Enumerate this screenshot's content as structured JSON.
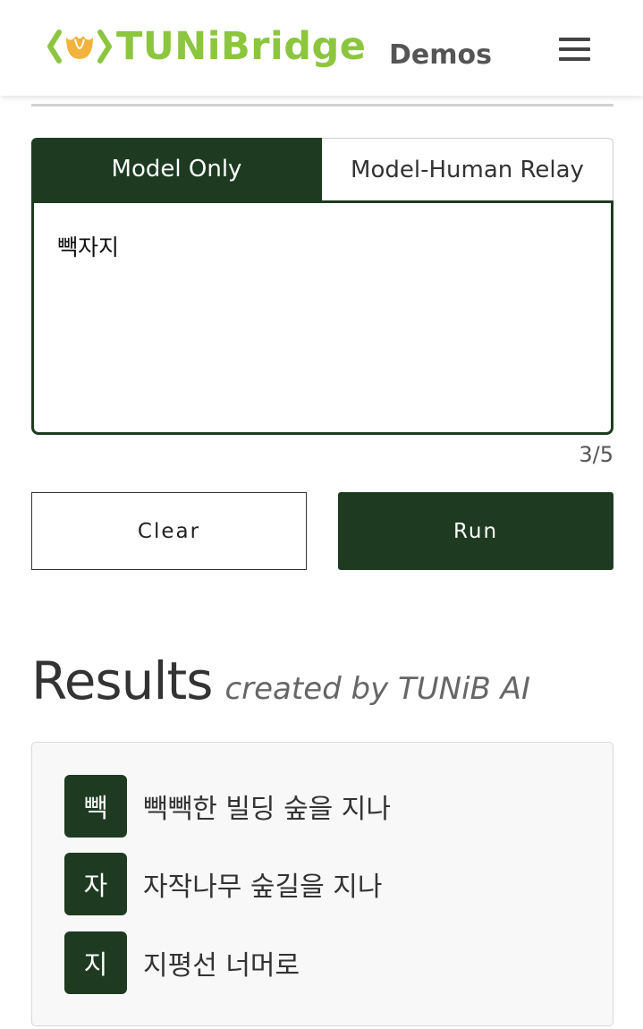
{
  "header": {
    "logo_text": "TUNiBridge",
    "section_label": "Demos",
    "colors": {
      "logo_green": "#8cc63f",
      "logo_orange": "#f2b33d"
    }
  },
  "tabs": [
    {
      "label": "Model Only",
      "active": true
    },
    {
      "label": "Model-Human Relay",
      "active": false
    }
  ],
  "input": {
    "value": "빽자지",
    "counter": "3/5"
  },
  "buttons": {
    "clear_label": "Clear",
    "run_label": "Run"
  },
  "results": {
    "title": "Results",
    "subtitle": "created by TUNiB AI",
    "lines": [
      {
        "char": "빽",
        "text": "빽빽한 빌딩 숲을 지나"
      },
      {
        "char": "자",
        "text": "자작나무 숲길을 지나"
      },
      {
        "char": "지",
        "text": "지평선 너머로"
      }
    ]
  },
  "colors": {
    "primary": "#1e3b22",
    "divider": "#d0d0d0",
    "results_bg": "#f8f8f8"
  }
}
